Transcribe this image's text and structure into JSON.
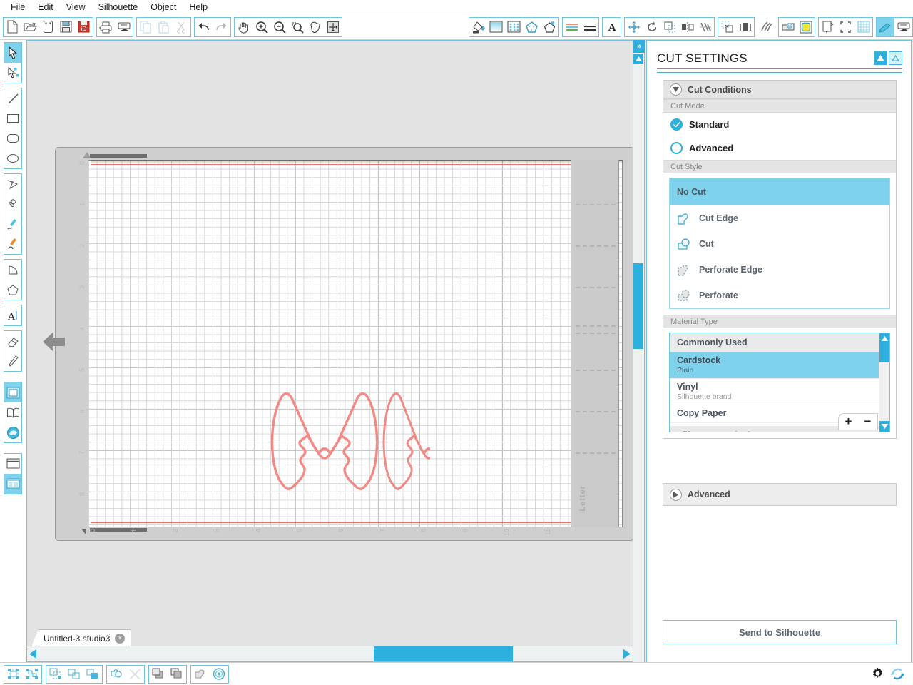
{
  "menu": {
    "items": [
      "File",
      "Edit",
      "View",
      "Silhouette",
      "Object",
      "Help"
    ]
  },
  "toolbar": {
    "groups": [
      {
        "name": "file-group",
        "buttons": [
          {
            "name": "new-document-icon",
            "label": "New"
          },
          {
            "name": "open-document-icon",
            "label": "Open"
          },
          {
            "name": "save-as-icon",
            "label": "Save As"
          },
          {
            "name": "save-icon",
            "label": "Save"
          },
          {
            "name": "save-to-library-icon",
            "label": "Save to Library"
          }
        ]
      },
      {
        "name": "print-group",
        "buttons": [
          {
            "name": "print-icon",
            "label": "Print"
          },
          {
            "name": "send-to-silhouette-icon",
            "label": "Send to Silhouette"
          }
        ]
      },
      {
        "name": "clipboard-group",
        "buttons": [
          {
            "name": "copy-icon",
            "label": "Copy"
          },
          {
            "name": "paste-icon",
            "label": "Paste"
          },
          {
            "name": "cut-icon",
            "label": "Cut"
          }
        ]
      },
      {
        "name": "history-group",
        "buttons": [
          {
            "name": "undo-icon",
            "label": "Undo"
          },
          {
            "name": "redo-icon",
            "label": "Redo"
          }
        ]
      },
      {
        "name": "view-group",
        "buttons": [
          {
            "name": "pan-hand-icon",
            "label": "Pan"
          },
          {
            "name": "zoom-in-icon",
            "label": "Zoom In"
          },
          {
            "name": "zoom-out-icon",
            "label": "Zoom Out"
          },
          {
            "name": "zoom-selection-icon",
            "label": "Zoom to Selection"
          },
          {
            "name": "zoom-fit-icon",
            "label": "Fit to Page"
          },
          {
            "name": "zoom-region-icon",
            "label": "Zoom Region"
          }
        ]
      },
      {
        "name": "fill-group",
        "buttons": [
          {
            "name": "fill-color-icon",
            "label": "Fill Color"
          },
          {
            "name": "fill-gradient-icon",
            "label": "Gradient Fill"
          },
          {
            "name": "fill-pattern-icon",
            "label": "Pattern Fill"
          },
          {
            "name": "line-color-icon",
            "label": "Line Color"
          },
          {
            "name": "line-style-icon",
            "label": "Line Style"
          }
        ]
      },
      {
        "name": "sketch-group",
        "buttons": [
          {
            "name": "sketch-color-icon",
            "label": "Sketch"
          },
          {
            "name": "line-weight-icon",
            "label": "Line Weight"
          }
        ]
      },
      {
        "name": "text-group",
        "buttons": [
          {
            "name": "text-style-icon",
            "label": "Text Style"
          }
        ]
      },
      {
        "name": "transform-group",
        "buttons": [
          {
            "name": "move-icon",
            "label": "Move"
          },
          {
            "name": "rotate-icon",
            "label": "Rotate"
          },
          {
            "name": "scale-icon",
            "label": "Scale"
          },
          {
            "name": "mirror-icon",
            "label": "Mirror"
          },
          {
            "name": "align-icon",
            "label": "Align"
          }
        ]
      },
      {
        "name": "modify-group",
        "buttons": [
          {
            "name": "replicate-icon",
            "label": "Replicate"
          },
          {
            "name": "offset-icon",
            "label": "Offset"
          }
        ]
      },
      {
        "name": "page-group",
        "buttons": [
          {
            "name": "page-setup-icon",
            "label": "Page Setup"
          },
          {
            "name": "registration-marks-icon",
            "label": "Registration Marks"
          },
          {
            "name": "grid-icon",
            "label": "Grid"
          }
        ]
      },
      {
        "name": "cut-group",
        "buttons": [
          {
            "name": "cut-settings-icon",
            "label": "Cut Settings",
            "selected": true
          },
          {
            "name": "send-panel-icon",
            "label": "Send"
          }
        ]
      }
    ]
  },
  "left_tools": {
    "groups": [
      {
        "name": "select-group",
        "tools": [
          {
            "name": "select-tool",
            "label": "Select",
            "selected": true
          },
          {
            "name": "edit-points-tool",
            "label": "Edit Points"
          }
        ]
      },
      {
        "name": "shape-group",
        "tools": [
          {
            "name": "line-tool",
            "label": "Line"
          },
          {
            "name": "rectangle-tool",
            "label": "Rectangle"
          },
          {
            "name": "rounded-rectangle-tool",
            "label": "Rounded Rectangle"
          },
          {
            "name": "ellipse-tool",
            "label": "Ellipse"
          }
        ]
      },
      {
        "name": "draw-group",
        "tools": [
          {
            "name": "polygon-tool",
            "label": "Polygon"
          },
          {
            "name": "curve-tool",
            "label": "Curve"
          },
          {
            "name": "freehand-tool",
            "label": "Freehand"
          },
          {
            "name": "smooth-freehand-tool",
            "label": "Smooth Freehand"
          }
        ]
      },
      {
        "name": "arc-group",
        "tools": [
          {
            "name": "arc-tool",
            "label": "Arc"
          },
          {
            "name": "regular-polygon-tool",
            "label": "Regular Polygon"
          }
        ]
      },
      {
        "name": "text-group",
        "tools": [
          {
            "name": "text-tool",
            "label": "Text"
          }
        ]
      },
      {
        "name": "erase-group",
        "tools": [
          {
            "name": "eraser-tool",
            "label": "Eraser"
          },
          {
            "name": "knife-tool",
            "label": "Knife"
          }
        ]
      },
      {
        "name": "workspace-group",
        "tools": [
          {
            "name": "design-page-tool",
            "label": "Design Page",
            "selected": true
          },
          {
            "name": "library-tool",
            "label": "Library"
          },
          {
            "name": "store-tool",
            "label": "Silhouette Design Store"
          }
        ]
      },
      {
        "name": "layout-group",
        "tools": [
          {
            "name": "single-view-tool",
            "label": "Single View"
          },
          {
            "name": "split-view-tool",
            "label": "Split View",
            "selected": true
          }
        ]
      }
    ]
  },
  "canvas": {
    "mat_label": "Letter",
    "ruler_left": [
      "0",
      "1",
      "2",
      "3",
      "4",
      "5",
      "6",
      "7",
      "8"
    ],
    "ruler_bottom": [
      "0",
      "1",
      "2",
      "3",
      "4",
      "5",
      "6",
      "7",
      "8",
      "9",
      "10",
      "11"
    ],
    "shape_stroke_color": "#f28a85",
    "cutline_color": "#e8736b",
    "shapes": [
      {
        "name": "butterfly-shape-left"
      },
      {
        "name": "butterfly-shape-right"
      }
    ]
  },
  "document_tab": {
    "title": "Untitled-3.studio3",
    "close_label": "×"
  },
  "panel": {
    "title": "CUT SETTINGS",
    "collapse_up_label": "▲",
    "collapse_out_label": "△",
    "cut_conditions": {
      "header": "Cut Conditions",
      "cut_mode": {
        "label": "Cut Mode",
        "options": [
          {
            "label": "Standard",
            "selected": true
          },
          {
            "label": "Advanced",
            "selected": false
          }
        ]
      },
      "cut_style": {
        "label": "Cut Style",
        "options": [
          {
            "label": "No Cut",
            "icon": "no-cut-icon",
            "selected": true
          },
          {
            "label": "Cut Edge",
            "icon": "cut-edge-icon",
            "selected": false
          },
          {
            "label": "Cut",
            "icon": "cut-icon",
            "selected": false
          },
          {
            "label": "Perforate Edge",
            "icon": "perforate-edge-icon",
            "selected": false
          },
          {
            "label": "Perforate",
            "icon": "perforate-icon",
            "selected": false
          }
        ]
      },
      "material_type": {
        "label": "Material Type",
        "groups": [
          {
            "label": "Commonly Used",
            "type": "group"
          },
          {
            "label": "Cardstock",
            "sub": "Plain",
            "selected": true
          },
          {
            "label": "Vinyl",
            "sub": "Silhouette brand",
            "selected": false
          },
          {
            "label": "Copy Paper",
            "sub": "",
            "selected": false
          },
          {
            "label": "Silhouette Defaults",
            "type": "group"
          }
        ],
        "add_label": "+",
        "remove_label": "−"
      }
    },
    "advanced": {
      "header": "Advanced"
    },
    "send_button": "Send to Silhouette"
  },
  "bottom_bar": {
    "groups": [
      {
        "name": "group-tools",
        "buttons": [
          {
            "name": "group-icon",
            "label": "Group"
          },
          {
            "name": "ungroup-icon",
            "label": "Ungroup"
          }
        ]
      },
      {
        "name": "compound-tools",
        "buttons": [
          {
            "name": "make-compound-path-icon",
            "label": "Make Compound Path"
          },
          {
            "name": "release-compound-path-icon",
            "label": "Release Compound Path"
          },
          {
            "name": "merge-icon",
            "label": "Merge"
          }
        ]
      },
      {
        "name": "weld-tools",
        "buttons": [
          {
            "name": "weld-icon",
            "label": "Weld"
          },
          {
            "name": "detach-icon",
            "label": "Detach Lines"
          }
        ]
      },
      {
        "name": "arrange-tools",
        "buttons": [
          {
            "name": "bring-to-front-icon",
            "label": "Bring to Front"
          },
          {
            "name": "send-to-back-icon",
            "label": "Send to Back"
          }
        ]
      },
      {
        "name": "offset-tools",
        "buttons": [
          {
            "name": "offset-shape-icon",
            "label": "Offset"
          },
          {
            "name": "internal-offset-icon",
            "label": "Internal Offset"
          }
        ]
      }
    ],
    "right_buttons": [
      {
        "name": "preferences-gear-icon",
        "label": "Preferences"
      },
      {
        "name": "sync-icon",
        "label": "Sync"
      }
    ]
  },
  "colors": {
    "accent": "#2db0dd",
    "accent_light": "#7fd2ec",
    "shape": "#f28a85",
    "panel_bg": "#ffffff",
    "canvas_bg": "#e3e3e3"
  }
}
